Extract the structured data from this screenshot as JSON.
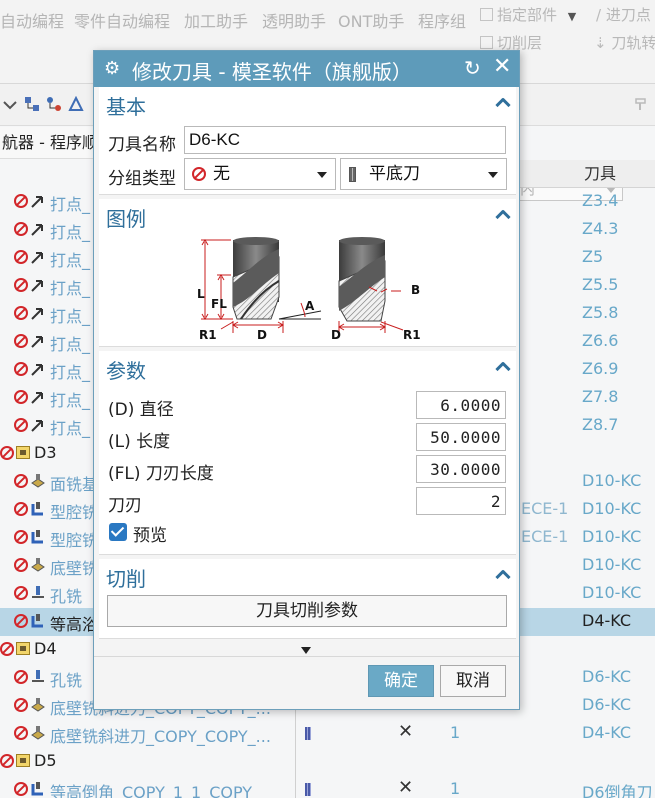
{
  "ribbon": {
    "items": [
      "自动编程",
      "零件自动编程",
      "加工助手",
      "透明助手",
      "ONT助手",
      "程序组"
    ],
    "right_row1": [
      "指定部件",
      "进刀点"
    ],
    "right_row2": [
      "切削层",
      "刀轨转"
    ]
  },
  "toolbar": {
    "select_value": "内"
  },
  "navigator": {
    "title": "航器 - 程序顺",
    "tool_column": "刀具"
  },
  "tree": {
    "rows": [
      {
        "label": "打点_",
        "tool": "Z3.4",
        "kind": "op"
      },
      {
        "label": "打点_",
        "tool": "Z4.3",
        "kind": "op"
      },
      {
        "label": "打点_",
        "tool": "Z5",
        "kind": "op"
      },
      {
        "label": "打点_",
        "tool": "Z5.5",
        "kind": "op"
      },
      {
        "label": "打点_",
        "tool": "Z5.8",
        "kind": "op"
      },
      {
        "label": "打点_",
        "tool": "Z6.6",
        "kind": "op"
      },
      {
        "label": "打点_",
        "tool": "Z6.9",
        "kind": "op"
      },
      {
        "label": "打点_",
        "tool": "Z7.8",
        "kind": "op"
      },
      {
        "label": "打点_",
        "tool": "Z8.7",
        "kind": "op"
      },
      {
        "label": "D3",
        "tool": "",
        "kind": "group"
      },
      {
        "label": "面铣基",
        "tool": "D10-KC",
        "kind": "op"
      },
      {
        "label": "型腔铣",
        "tool": "D10-KC",
        "ece": "ECE-1",
        "kind": "op"
      },
      {
        "label": "型腔铣",
        "tool": "D10-KC",
        "ece": "ECE-1",
        "kind": "op"
      },
      {
        "label": "底壁铣",
        "tool": "D10-KC",
        "kind": "op"
      },
      {
        "label": "孔铣",
        "tool": "D10-KC",
        "kind": "op"
      },
      {
        "label": "等高浴",
        "tool": "D4-KC",
        "kind": "op",
        "selected": true
      },
      {
        "label": "D4",
        "tool": "",
        "kind": "group"
      },
      {
        "label": "孔铣",
        "tool": "D6-KC",
        "kind": "op"
      },
      {
        "label": "底壁铣斜进刀_COPY_COPY_...",
        "tool": "D6-KC",
        "kind": "op"
      },
      {
        "label": "底壁铣斜进刀_COPY_COPY_...",
        "tool": "D4-KC",
        "kind": "op",
        "xmark": "✕",
        "num": "1"
      },
      {
        "label": "D5",
        "tool": "",
        "kind": "group"
      },
      {
        "label": "等高倒角_COPY_1_1_COPY",
        "tool": "D6倒角刀",
        "kind": "op",
        "xmark": "✕",
        "num": "1"
      }
    ]
  },
  "dialog": {
    "title": "修改刀具 - 模圣软件（旗舰版）",
    "basic": {
      "header": "基本",
      "tool_name_label": "刀具名称",
      "tool_name_value": "D6-KC",
      "group_type_label": "分组类型",
      "group_value": "无",
      "tool_type_value": "平底刀"
    },
    "legend": {
      "header": "图例",
      "labels": {
        "L": "L",
        "FL": "FL",
        "A": "A",
        "R1_left": "R1",
        "D_left": "D",
        "B": "B",
        "D_right": "D",
        "R1_right": "R1"
      }
    },
    "params": {
      "header": "参数",
      "diameter_label": "(D) 直径",
      "diameter_value": "6.0000",
      "length_label": "(L) 长度",
      "length_value": "50.0000",
      "flute_length_label": "(FL) 刀刃长度",
      "flute_length_value": "30.0000",
      "flutes_label": "刀刃",
      "flutes_value": "2",
      "preview_label": "预览"
    },
    "cut": {
      "header": "切削",
      "button_label": "刀具切削参数"
    },
    "ok_label": "确定",
    "cancel_label": "取消"
  },
  "colors": {
    "title_bar": "#5e9bba",
    "section_header": "#2f6f9b",
    "ok_button": "#6aa9c6",
    "tree_text": "#6ba1c7",
    "selected_row": "#b8d6e6",
    "error_red": "#d2262a"
  }
}
